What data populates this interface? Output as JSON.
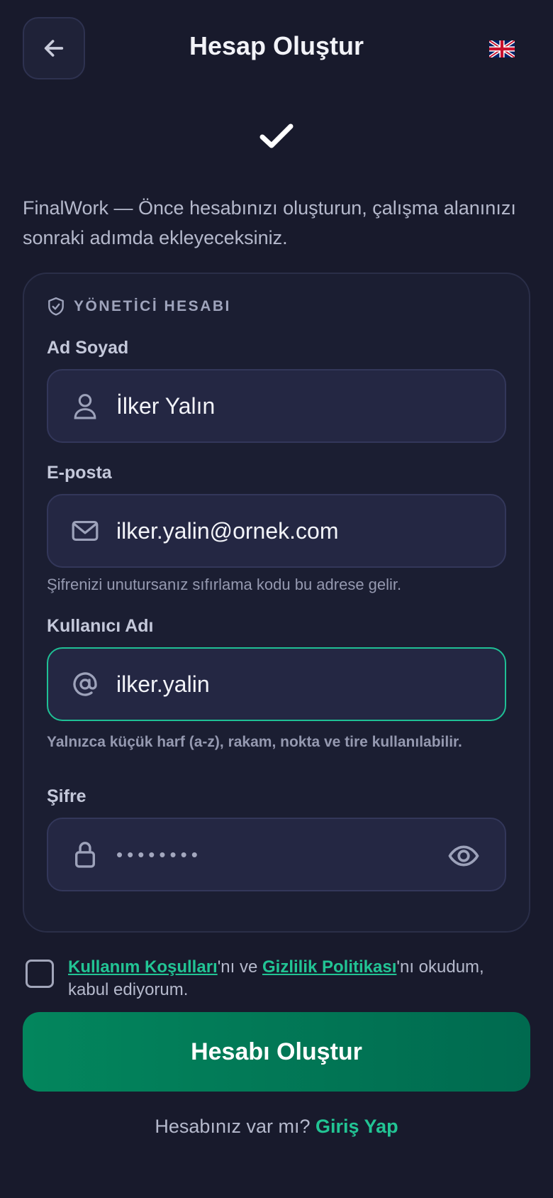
{
  "header": {
    "title": "Hesap Oluştur",
    "back_icon": "arrow-left-icon",
    "language_icon": "uk-flag-icon"
  },
  "intro_text": "FinalWork — Önce hesabınızı oluşturun, çalışma alanınızı sonraki adımda ekleyeceksiniz.",
  "form": {
    "section_title": "YÖNETİCİ HESABI",
    "full_name": {
      "label": "Ad Soyad",
      "value": "İlker Yalın",
      "icon": "user-icon"
    },
    "email": {
      "label": "E-posta",
      "value": "ilker.yalin@ornek.com",
      "icon": "mail-icon",
      "help": "Şifrenizi unutursanız sıfırlama kodu bu adrese gelir."
    },
    "username": {
      "label": "Kullanıcı Adı",
      "value": "ilker.yalin",
      "icon": "at-icon",
      "help": "Yalnızca küçük harf (a-z), rakam, nokta ve tire kullanılabilir."
    },
    "password": {
      "label": "Şifre",
      "value": "••••••••",
      "icon": "lock-icon",
      "toggle_icon": "eye-icon"
    }
  },
  "terms": {
    "checked": false,
    "terms_link": "Kullanım Koşulları",
    "mid_text": "'nı ve ",
    "privacy_link": "Gizlilik Politikası",
    "end_text": "'nı okudum, kabul ediyorum."
  },
  "submit_label": "Hesabı Oluştur",
  "login": {
    "prompt": "Hesabınız var mı?",
    "link": "Giriş Yap"
  },
  "colors": {
    "background": "#181a2c",
    "accent": "#22c494",
    "button_start": "#03865d",
    "button_end": "#006a4f",
    "field_bg": "#242743",
    "active_border": "#1fc095"
  }
}
